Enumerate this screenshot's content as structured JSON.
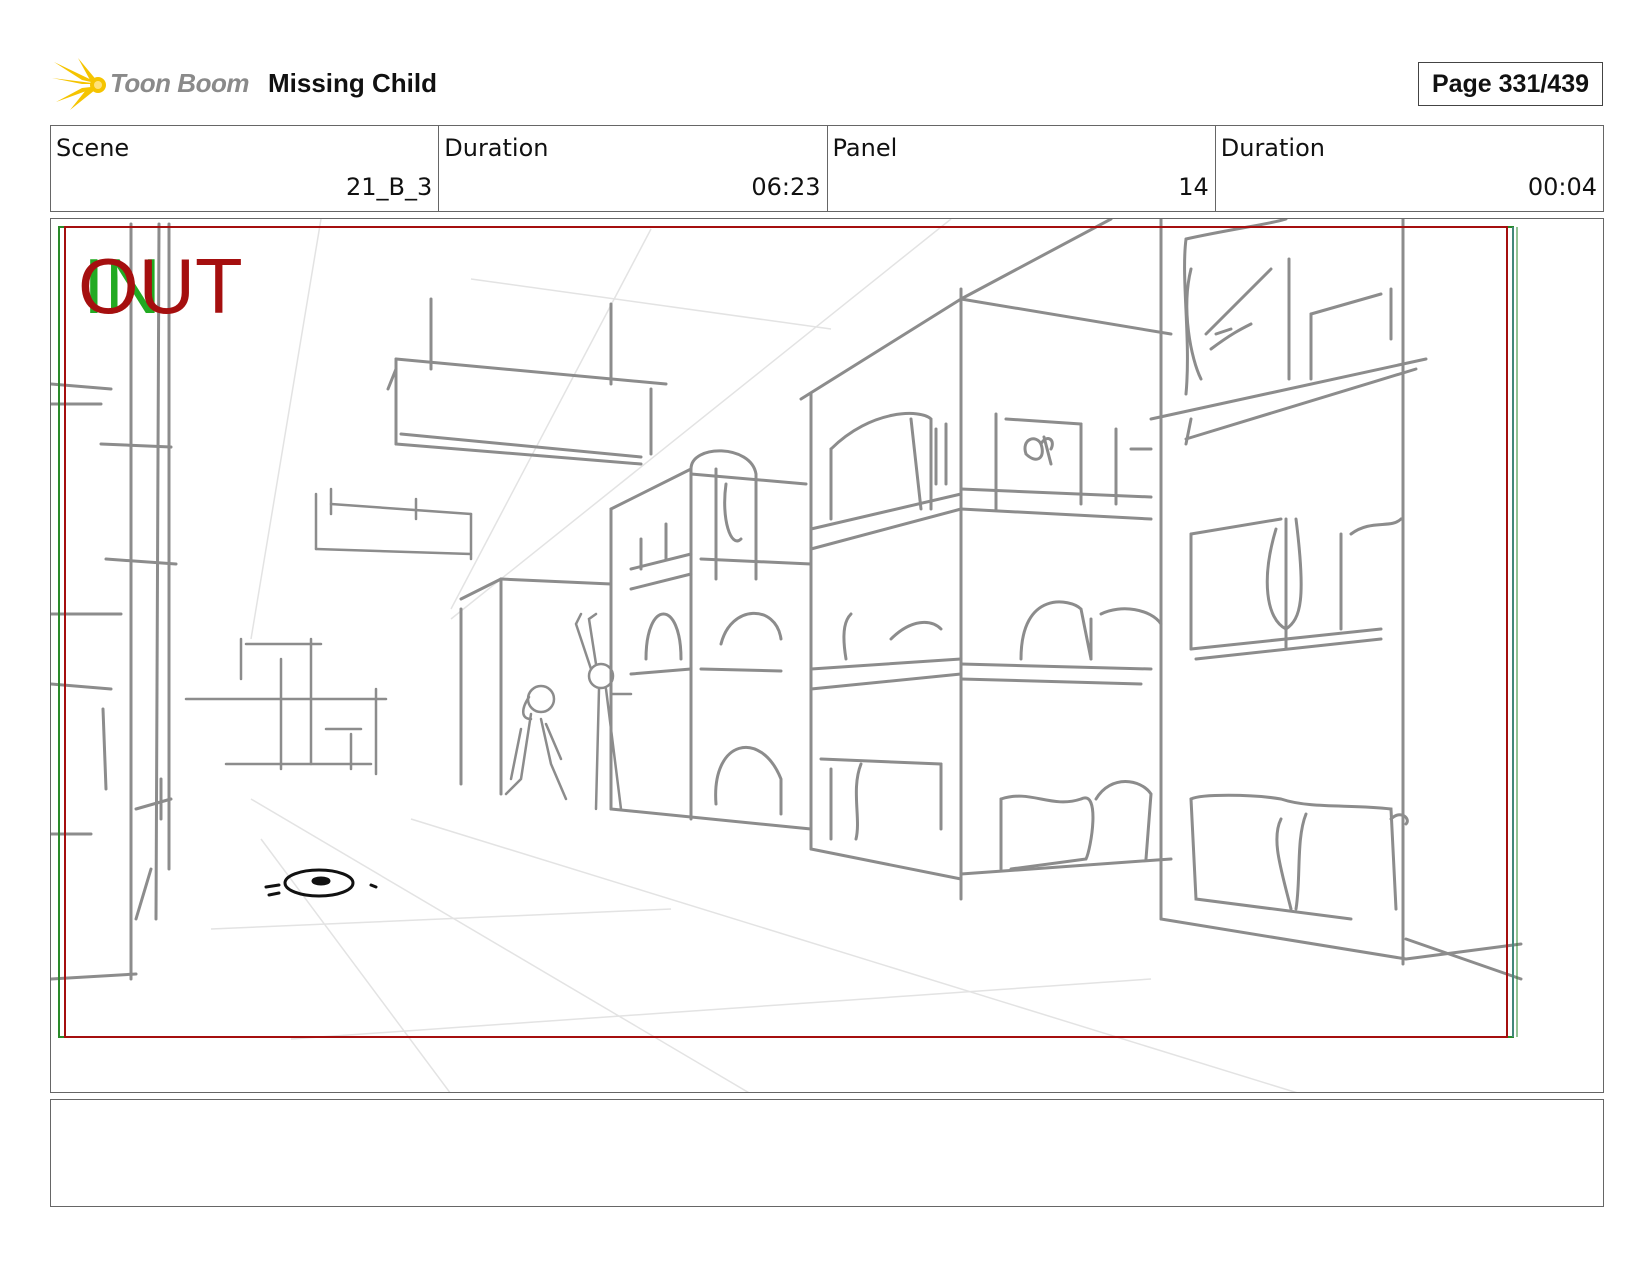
{
  "header": {
    "logo_text": "Toon Boom",
    "project_title": "Missing Child",
    "page_label": "Page 331/439"
  },
  "info": {
    "scene_label": "Scene",
    "scene_value": "21_B_3",
    "scene_duration_label": "Duration",
    "scene_duration_value": "06:23",
    "panel_label": "Panel",
    "panel_value": "14",
    "panel_duration_label": "Duration",
    "panel_duration_value": "00:04"
  },
  "panel": {
    "in_marker": "IN",
    "out_marker": "OUT"
  },
  "notes": {
    "text": ""
  },
  "colors": {
    "safe_frame_red": "#a50f0f",
    "safe_frame_green": "#2a8a2a",
    "sketch_gray": "#8c8c8c",
    "logo_yellow": "#f5c400"
  }
}
